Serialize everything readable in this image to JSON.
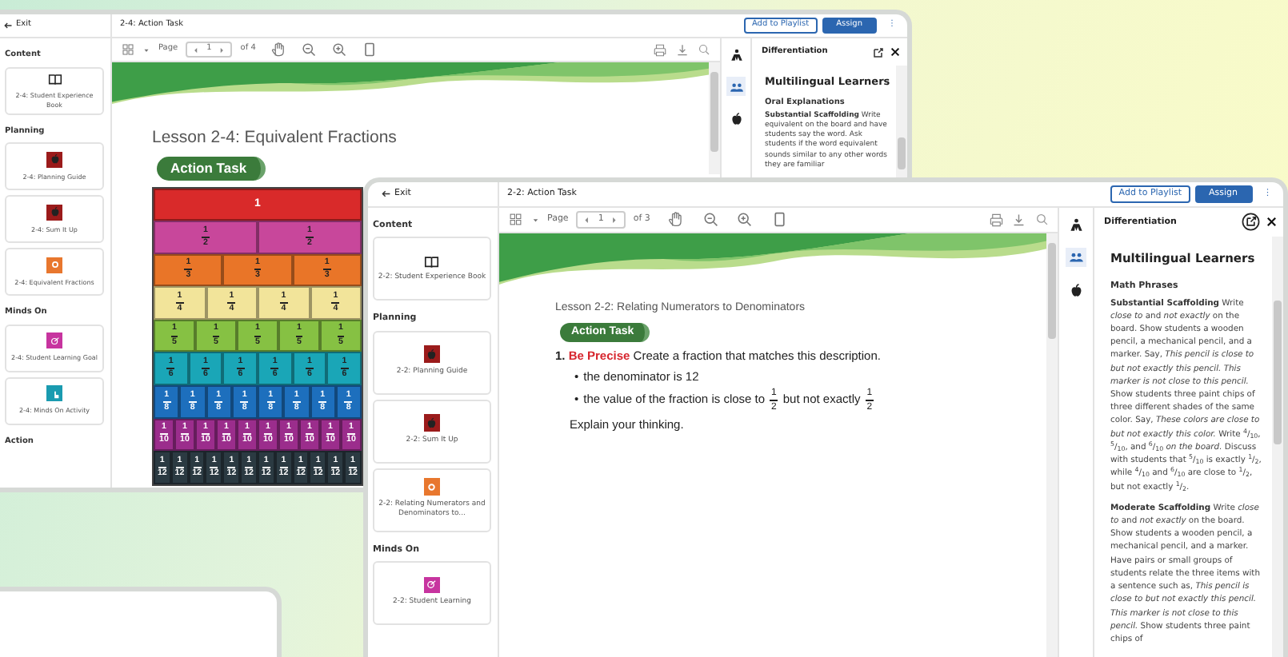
{
  "back_window": {
    "exit": "Exit",
    "title": "2-4: Action Task",
    "header_buttons": [
      {
        "kind": "outline",
        "label": "Add to Playlist"
      },
      {
        "kind": "primary",
        "label": "Assign"
      },
      {
        "kind": "more",
        "label": "⋮"
      }
    ],
    "sidebar": [
      {
        "title": "Content",
        "items": [
          {
            "label": "2-4: Student Experience Book",
            "kind": "book"
          }
        ]
      },
      {
        "title": "Planning",
        "items": [
          {
            "label": "2-4: Planning Guide",
            "kind": "apple",
            "color": "#9b1b1b"
          },
          {
            "label": "2-4: Sum It Up",
            "kind": "apple",
            "color": "#9b1b1b"
          },
          {
            "label": "2-4: Equivalent Fractions",
            "kind": "ring",
            "color": "#e8772e"
          }
        ]
      },
      {
        "title": "Minds On",
        "items": [
          {
            "label": "2-4: Student Learning Goal",
            "kind": "goal",
            "color": "#c7349f"
          },
          {
            "label": "2-4: Minds On Activity",
            "kind": "hand",
            "color": "#1a9bb0"
          }
        ]
      },
      {
        "title": "Action"
      }
    ],
    "toolbar": {
      "page_label": "Page",
      "page": "1",
      "page_count": "of 4"
    },
    "document": {
      "lesson_title": "Lesson 2-4: Equivalent Fractions",
      "badge": "Action Task",
      "fraction_strips": [
        {
          "color": "#d92a2a",
          "cells": [
            {
              "kind": "whole",
              "text": "1"
            }
          ]
        },
        {
          "color": "#c8479b",
          "cells": [
            {
              "kind": "fraction",
              "numerator": "1",
              "denominator": "2"
            },
            {
              "kind": "fraction",
              "numerator": "1",
              "denominator": "2"
            }
          ]
        },
        {
          "color": "#e97528",
          "cells": [
            {
              "kind": "fraction",
              "numerator": "1",
              "denominator": "3"
            },
            {
              "kind": "fraction",
              "numerator": "1",
              "denominator": "3"
            },
            {
              "kind": "fraction",
              "numerator": "1",
              "denominator": "3"
            }
          ]
        },
        {
          "color": "#f2e49a",
          "cells": [
            {
              "kind": "fraction",
              "numerator": "1",
              "denominator": "4"
            },
            {
              "kind": "fraction",
              "numerator": "1",
              "denominator": "4"
            },
            {
              "kind": "fraction",
              "numerator": "1",
              "denominator": "4"
            },
            {
              "kind": "fraction",
              "numerator": "1",
              "denominator": "4"
            }
          ]
        },
        {
          "color": "#86c143",
          "cells": [
            {
              "kind": "fraction",
              "numerator": "1",
              "denominator": "5"
            },
            {
              "kind": "fraction",
              "numerator": "1",
              "denominator": "5"
            },
            {
              "kind": "fraction",
              "numerator": "1",
              "denominator": "5"
            },
            {
              "kind": "fraction",
              "numerator": "1",
              "denominator": "5"
            },
            {
              "kind": "fraction",
              "numerator": "1",
              "denominator": "5"
            }
          ]
        },
        {
          "color": "#1aa6b7",
          "cells": [
            {
              "kind": "fraction",
              "numerator": "1",
              "denominator": "6"
            },
            {
              "kind": "fraction",
              "numerator": "1",
              "denominator": "6"
            },
            {
              "kind": "fraction",
              "numerator": "1",
              "denominator": "6"
            },
            {
              "kind": "fraction",
              "numerator": "1",
              "denominator": "6"
            },
            {
              "kind": "fraction",
              "numerator": "1",
              "denominator": "6"
            },
            {
              "kind": "fraction",
              "numerator": "1",
              "denominator": "6"
            }
          ]
        },
        {
          "color": "#1d6fbd",
          "cells": [
            {
              "kind": "fraction",
              "numerator": "1",
              "denominator": "8"
            },
            {
              "kind": "fraction",
              "numerator": "1",
              "denominator": "8"
            },
            {
              "kind": "fraction",
              "numerator": "1",
              "denominator": "8"
            },
            {
              "kind": "fraction",
              "numerator": "1",
              "denominator": "8"
            },
            {
              "kind": "fraction",
              "numerator": "1",
              "denominator": "8"
            },
            {
              "kind": "fraction",
              "numerator": "1",
              "denominator": "8"
            },
            {
              "kind": "fraction",
              "numerator": "1",
              "denominator": "8"
            },
            {
              "kind": "fraction",
              "numerator": "1",
              "denominator": "8"
            }
          ]
        },
        {
          "color": "#9b2d8c",
          "cells": [
            {
              "kind": "fraction",
              "numerator": "1",
              "denominator": "10"
            },
            {
              "kind": "fraction",
              "numerator": "1",
              "denominator": "10"
            },
            {
              "kind": "fraction",
              "numerator": "1",
              "denominator": "10"
            },
            {
              "kind": "fraction",
              "numerator": "1",
              "denominator": "10"
            },
            {
              "kind": "fraction",
              "numerator": "1",
              "denominator": "10"
            },
            {
              "kind": "fraction",
              "numerator": "1",
              "denominator": "10"
            },
            {
              "kind": "fraction",
              "numerator": "1",
              "denominator": "10"
            },
            {
              "kind": "fraction",
              "numerator": "1",
              "denominator": "10"
            },
            {
              "kind": "fraction",
              "numerator": "1",
              "denominator": "10"
            },
            {
              "kind": "fraction",
              "numerator": "1",
              "denominator": "10"
            }
          ]
        },
        {
          "color": "#2b3a42",
          "cells": [
            {
              "kind": "fraction",
              "numerator": "1",
              "denominator": "12"
            },
            {
              "kind": "fraction",
              "numerator": "1",
              "denominator": "12"
            },
            {
              "kind": "fraction",
              "numerator": "1",
              "denominator": "12"
            },
            {
              "kind": "fraction",
              "numerator": "1",
              "denominator": "12"
            },
            {
              "kind": "fraction",
              "numerator": "1",
              "denominator": "12"
            },
            {
              "kind": "fraction",
              "numerator": "1",
              "denominator": "12"
            },
            {
              "kind": "fraction",
              "numerator": "1",
              "denominator": "12"
            },
            {
              "kind": "fraction",
              "numerator": "1",
              "denominator": "12"
            },
            {
              "kind": "fraction",
              "numerator": "1",
              "denominator": "12"
            },
            {
              "kind": "fraction",
              "numerator": "1",
              "denominator": "12"
            },
            {
              "kind": "fraction",
              "numerator": "1",
              "denominator": "12"
            },
            {
              "kind": "fraction",
              "numerator": "1",
              "denominator": "12"
            }
          ]
        }
      ]
    },
    "panel": {
      "side_tabs": [
        {
          "kind": "person",
          "selected": false
        },
        {
          "kind": "people",
          "selected": true
        },
        {
          "kind": "apple",
          "selected": false
        }
      ],
      "title": "Differentiation",
      "heading": "Multilingual Learners",
      "subheading": "Oral Explanations",
      "paragraphs": [
        "**Substantial Scaffolding**  Write equivalent on the board and have students say the word. Ask students if the word equivalent sounds similar to any other words they are familiar"
      ]
    }
  },
  "front_window": {
    "exit": "Exit",
    "title": "2-2: Action Task",
    "header_buttons": [
      {
        "kind": "outline",
        "label": "Add to Playlist"
      },
      {
        "kind": "primary",
        "label": "Assign"
      },
      {
        "kind": "more",
        "label": "⋮"
      }
    ],
    "sidebar": [
      {
        "title": "Content",
        "items": [
          {
            "label": "2-2: Student Experience Book",
            "kind": "book"
          }
        ]
      },
      {
        "title": "Planning",
        "items": [
          {
            "label": "2-2: Planning Guide",
            "kind": "apple",
            "color": "#9b1b1b"
          },
          {
            "label": "2-2: Sum It Up",
            "kind": "apple",
            "color": "#9b1b1b"
          },
          {
            "label": "2-2: Relating Numerators and Denominators to...",
            "kind": "ring",
            "color": "#e8772e"
          }
        ]
      },
      {
        "title": "Minds On",
        "items": [
          {
            "label": "2-2: Student Learning",
            "kind": "goal",
            "color": "#c7349f"
          }
        ]
      }
    ],
    "toolbar": {
      "page_label": "Page",
      "page": "1",
      "page_count": "of 3"
    },
    "document": {
      "lesson_title": "Lesson 2-2: Relating Numerators to Denominators",
      "badge": "Action Task",
      "task": {
        "number": "1.",
        "label": "Be Precise",
        "text": "Create a fraction that matches this description.",
        "bullets": [
          {
            "marker": "•",
            "segments": [
              {
                "kind": "text",
                "text": "the denominator is 12"
              }
            ]
          },
          {
            "marker": "•",
            "segments": [
              {
                "kind": "text",
                "text": "the value of the fraction is close to"
              },
              {
                "kind": "fraction",
                "numerator": "1",
                "denominator": "2"
              },
              {
                "kind": "text",
                "text": "but not exactly"
              },
              {
                "kind": "fraction",
                "numerator": "1",
                "denominator": "2"
              }
            ]
          }
        ],
        "closing": "Explain your thinking."
      }
    },
    "panel": {
      "side_tabs": [
        {
          "kind": "person",
          "selected": false
        },
        {
          "kind": "people",
          "selected": true
        },
        {
          "kind": "apple",
          "selected": false
        }
      ],
      "title": "Differentiation",
      "heading": "Multilingual Learners",
      "subheading": "Math Phrases",
      "paragraphs": [
        "**Substantial Scaffolding**  Write *close to* and *not exactly* on the board. Show students a wooden pencil, a mechanical pencil, and a marker. Say, *This pencil is close to but not exactly this pencil. This marker is not close to this pencil.* Show students three paint chips of three different shades of the same color. Say, *These colors are close to but not exactly this color.* Write $^{4}$/$_{10}$, $^{5}$/$_{10}$, and $^{6}$/$_{10}$ *on the board.* Discuss with students that $^{5}$/$_{10}$ is exactly $^{1}$/$_{2}$, while $^{4}$/$_{10}$ and $^{6}$/$_{10}$ are close to $^{1}$/$_{2}$, but not exactly $^{1}$/$_{2}$.",
        "**Moderate Scaffolding**  Write *close to* and *not exactly* on the board. Show students a wooden pencil, a mechanical pencil, and a marker. Have pairs or small groups of students relate the three items with a sentence such as, *This pencil is close to but not exactly this pencil. This marker is not close to this pencil.* Show students three paint chips of"
      ]
    }
  }
}
